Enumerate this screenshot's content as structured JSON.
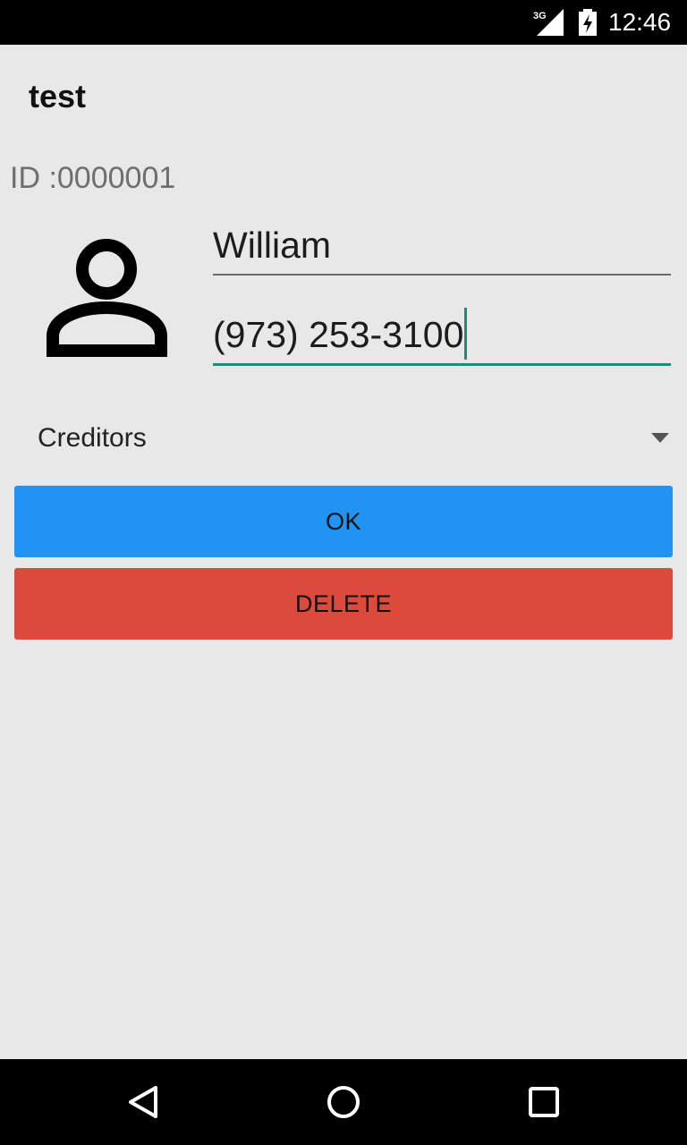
{
  "status_bar": {
    "network_label": "3G",
    "time": "12:46",
    "icons": [
      "signal-icon",
      "battery-charging-icon"
    ]
  },
  "app": {
    "title": "test"
  },
  "contact": {
    "id_text": "ID :0000001",
    "avatar_icon": "person-icon",
    "name_value": "William",
    "phone_value": "(973) 253-3100"
  },
  "category_select": {
    "selected": "Creditors"
  },
  "buttons": {
    "ok_label": "OK",
    "delete_label": "DELETE"
  },
  "colors": {
    "ok_button": "#2194f3",
    "delete_button": "#db4a3b",
    "focus_accent": "#1a8c80"
  },
  "nav_bar": {
    "icons": [
      "back-icon",
      "home-icon",
      "recents-icon"
    ]
  }
}
